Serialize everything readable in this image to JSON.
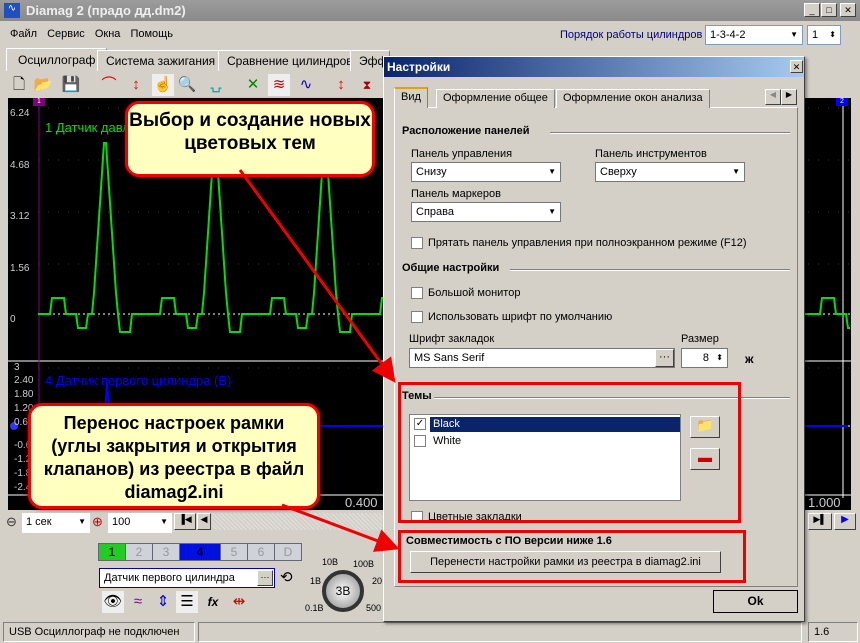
{
  "app": {
    "title": "Diamag 2 (прадо дд.dm2)"
  },
  "menu": [
    "Файл",
    "Сервис",
    "Окна",
    "Помощь"
  ],
  "cylinder_order": {
    "label": "Порядок работы цилиндров",
    "value": "1-3-4-2",
    "spin": "1"
  },
  "main_tabs": [
    "Осциллограф",
    "Система зажигания",
    "Сравнение цилиндров",
    "Эфф"
  ],
  "scope": {
    "ch1_label": "1 Датчик давл",
    "ch1_ticks": [
      "6.24",
      "4.68",
      "3.12",
      "1.56",
      "0"
    ],
    "ch4_label": "4 Датчик первого цилиндра (В)",
    "ch4_ticks": [
      "3",
      "2.40",
      "1.80",
      "1.20",
      "0.6",
      "-0.6",
      "-1.2",
      "-1.8",
      "-2.4"
    ],
    "x_ticks": [
      "0.400",
      "1.000"
    ],
    "marker1": "1",
    "marker2": "2",
    "trace_colors": {
      "ch1": "#00e000",
      "ch4": "#0000ff"
    }
  },
  "bottom_toolbar": {
    "time": "1 сек",
    "zoom": "100"
  },
  "channels": {
    "buttons": [
      "1",
      "2",
      "3",
      "4",
      "5",
      "6",
      "D"
    ],
    "active": "4",
    "sensor": "Датчик первого цилиндра",
    "dial_value": "3В",
    "dial_labels": [
      "10В",
      "100В",
      "1В",
      "20",
      "0.1В",
      "500"
    ]
  },
  "status": {
    "left": "USB Осциллограф не подключен",
    "version": "1.6"
  },
  "dialog": {
    "title": "Настройки",
    "tabs": [
      "Вид",
      "Оформление общее",
      "Оформление окон анализа"
    ],
    "panels_section": "Расположение панелей",
    "control_panel": {
      "label": "Панель управления",
      "value": "Снизу"
    },
    "tool_panel": {
      "label": "Панель инструментов",
      "value": "Сверху"
    },
    "marker_panel": {
      "label": "Панель маркеров",
      "value": "Справа"
    },
    "hide_panel": {
      "label": "Прятать панель управления при полноэкранном режиме (F12)",
      "checked": false
    },
    "general_section": "Общие настройки",
    "big_monitor": {
      "label": "Большой монитор",
      "checked": false
    },
    "default_font": {
      "label": "Использовать шрифт по умолчанию",
      "checked": false
    },
    "tab_font": {
      "label": "Шрифт закладок",
      "value": "MS Sans Serif"
    },
    "size": {
      "label": "Размер",
      "value": "8"
    },
    "bold_label": "ж",
    "themes_section": "Темы",
    "themes": [
      {
        "name": "Black",
        "checked": true
      },
      {
        "name": "White",
        "checked": false
      }
    ],
    "color_tabs": {
      "label": "Цветные закладки",
      "checked": false
    },
    "compat_section": "Совместимость с ПО версии ниже 1.6",
    "transfer_button": "Перенести настройки рамки из реестра в diamag2.ini",
    "ok": "Ok"
  },
  "annotations": {
    "top": "Выбор и создание новых цветовых тем",
    "bottom": "Перенос настроек рамки (углы закрытия и открытия клапанов) из реестра в файл diamag2.ini"
  }
}
